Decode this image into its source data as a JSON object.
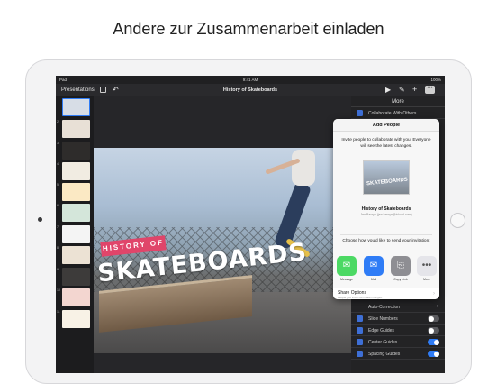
{
  "headline": "Andere zur Zusammenarbeit einladen",
  "status_bar": {
    "device": "iPad",
    "time": "9:41 AM",
    "battery": "100%"
  },
  "toolbar": {
    "presentations_label": "Presentations",
    "title": "History of Skateboards",
    "icons": [
      "slides-view-icon",
      "undo-icon",
      "play-icon",
      "format-brush-icon",
      "add-icon",
      "more-icon"
    ]
  },
  "navigator": {
    "slide_numbers": [
      "1",
      "2",
      "3",
      "4",
      "5",
      "6",
      "7",
      "8",
      "9",
      "10",
      "11"
    ]
  },
  "slide": {
    "tag_text": "HISTORY OF",
    "title_text": "SKATEBOARDS"
  },
  "more_panel": {
    "title": "More",
    "collaborate_label": "Collaborate With Others",
    "auto_correction_label": "Auto-Correction",
    "rows": [
      {
        "label": "Slide Numbers",
        "on": false
      },
      {
        "label": "Edge Guides",
        "on": false
      },
      {
        "label": "Center Guides",
        "on": true
      },
      {
        "label": "Spacing Guides",
        "on": true
      }
    ]
  },
  "popover": {
    "title": "Add People",
    "intro": "Invite people to collaborate with you. Everyone will see the latest changes.",
    "doc_title": "History of Skateboards",
    "doc_owner": "Jen Bacryn (jen.bacryn@icloud.com)",
    "choose_text": "Choose how you'd like to send your invitation:",
    "apps": [
      {
        "label": "Message",
        "color": "#4cd964",
        "icon": "message-icon"
      },
      {
        "label": "Mail",
        "color": "#2f7cf6",
        "icon": "mail-icon"
      },
      {
        "label": "Copy Link",
        "color": "#8e8e93",
        "icon": "copy-link-icon"
      },
      {
        "label": "More",
        "color": "#e5e5ea",
        "icon": "more-icon"
      }
    ],
    "share_options_label": "Share Options",
    "share_options_sub": "People you invite can make changes."
  }
}
